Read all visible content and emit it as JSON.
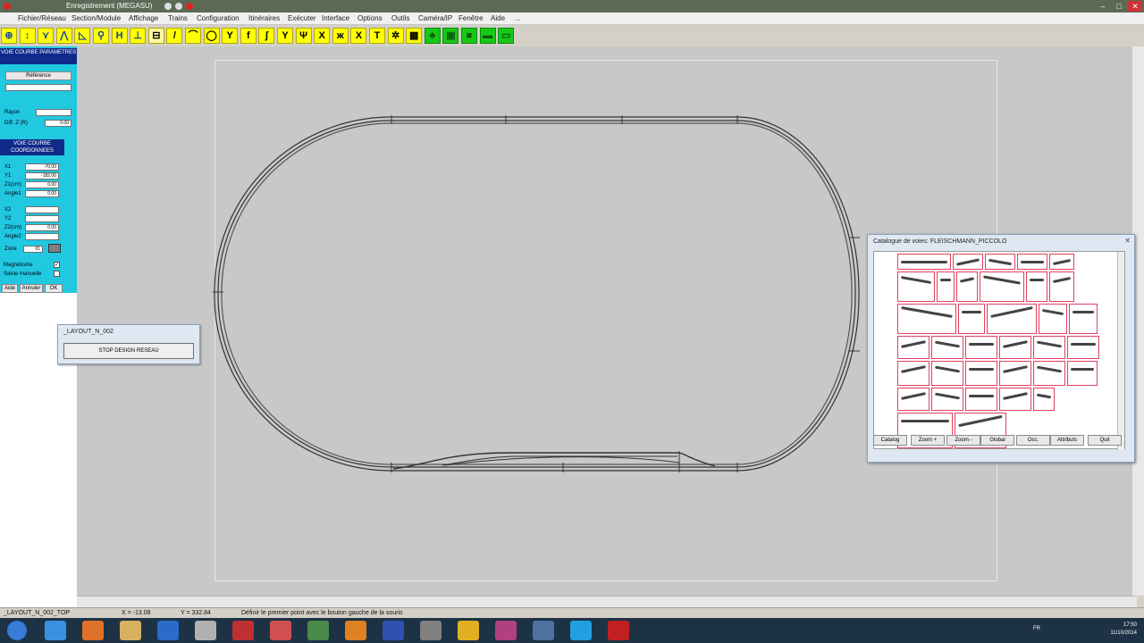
{
  "window": {
    "title": "Enregistrement (MEGASU)",
    "min": "–",
    "max": "□",
    "close": "✕"
  },
  "menu": [
    "Fichier/Réseau",
    "Section/Module",
    "Affichage",
    "Trains",
    "Configuration",
    "Itinéraires",
    "Exécuter",
    "Interface",
    "Options",
    "Outils",
    "Caméra/IP",
    "Fenêtre",
    "Aide",
    "..."
  ],
  "toolbar": {
    "buttons": [
      {
        "name": "globe-icon",
        "glyph": "⊕",
        "style": "blue"
      },
      {
        "name": "straight-track-icon",
        "glyph": "↕",
        "style": "blue"
      },
      {
        "name": "track-tool-icon",
        "glyph": "⋎",
        "style": "blue"
      },
      {
        "name": "double-track-icon",
        "glyph": "⋀",
        "style": "blue"
      },
      {
        "name": "track-end-icon",
        "glyph": "◺",
        "style": "blue"
      },
      {
        "name": "signal-tool-icon",
        "glyph": "⚲",
        "style": "blue"
      },
      {
        "name": "connector-icon",
        "glyph": "H",
        "style": "blue"
      },
      {
        "name": "bridge-icon",
        "glyph": "⊥",
        "style": "blue"
      },
      {
        "name": "track-catalog-icon",
        "glyph": "⊟",
        "style": "sel"
      },
      {
        "name": "line-draw-icon",
        "glyph": "/",
        "style": "y"
      },
      {
        "name": "curve-draw-icon",
        "glyph": "⌒",
        "style": "y"
      },
      {
        "name": "circle-track-icon",
        "glyph": "◯",
        "style": "y"
      },
      {
        "name": "turnout-icon",
        "glyph": "Y",
        "style": "y"
      },
      {
        "name": "turnout-left-icon",
        "glyph": "f",
        "style": "y"
      },
      {
        "name": "turnout-right-icon",
        "glyph": "ʃ",
        "style": "y"
      },
      {
        "name": "wye-icon",
        "glyph": "Y",
        "style": "y"
      },
      {
        "name": "three-way-icon",
        "glyph": "Ψ",
        "style": "y"
      },
      {
        "name": "crossing-icon",
        "glyph": "X",
        "style": "y"
      },
      {
        "name": "double-slip-icon",
        "glyph": "ж",
        "style": "y"
      },
      {
        "name": "diamond-crossing-icon",
        "glyph": "X",
        "style": "y"
      },
      {
        "name": "buffer-icon",
        "glyph": "T",
        "style": "y"
      },
      {
        "name": "turntable-icon",
        "glyph": "✲",
        "style": "y"
      },
      {
        "name": "building-icon",
        "glyph": "▦",
        "style": "y"
      },
      {
        "name": "tree-icon",
        "glyph": "♣",
        "style": "green"
      },
      {
        "name": "scenery-icon",
        "glyph": "▣",
        "style": "green"
      },
      {
        "name": "platform-icon",
        "glyph": "■",
        "style": "green"
      },
      {
        "name": "road-icon",
        "glyph": "▬",
        "style": "green"
      },
      {
        "name": "grass-icon",
        "glyph": "▭",
        "style": "green"
      }
    ]
  },
  "leftpanel": {
    "header1": "VOIE COURBE PARAMETRES",
    "ref_label": "Référence",
    "rayon_label": "Rayon",
    "diffz_label": "Diff. Z (R)",
    "diffz_value": "0.00",
    "header2": "VOIE COURBE COORDONNEES",
    "x1_label": "X1",
    "x1_value": "-70.00",
    "y1_label": "Y1",
    "y1_value": "-182.00",
    "z1_label": "Z1(cm)",
    "z1_value": "0.00",
    "angle1_label": "Angle1",
    "angle1_value": "0.00",
    "x2_label": "X2",
    "y2_label": "Y2",
    "z2_label": "Z2(cm)",
    "z2_value": "0.00",
    "angle2_label": "Angle2",
    "zone_label": "Zone",
    "zone_value": "01",
    "magnetisme_label": "Magnétisme",
    "saisie_label": "Saisie manuelle",
    "btn_aide": "Aide",
    "btn_annuler": "Annuler",
    "btn_ok": "OK"
  },
  "layout_dialog": {
    "title": "_LAYOUT_N_002",
    "button": "STOP DESIGN RESEAU"
  },
  "catalog": {
    "title": "Catalogue de voies: FLEISCHMANN_PICCOLO",
    "close": "✕",
    "buttons": [
      "Catalog",
      "Zoom +",
      "Zoom -",
      "Global",
      "Occ.",
      "Attributs",
      "Quit"
    ]
  },
  "statusbar": {
    "layout": "_LAYOUT_N_002_TOP",
    "x": "X = -13.08",
    "y": "Y = 332.84",
    "message": "Définir le premier point avec le bouton gauche de la souris"
  },
  "taskbar": {
    "icons": [
      "start-icon",
      "ie-icon",
      "firefox-icon",
      "explorer-icon",
      "app-icon",
      "tool-icon",
      "filezilla-icon",
      "app2-icon",
      "photo-icon",
      "vlc-icon",
      "network-icon",
      "app3-icon",
      "chrome-icon",
      "app4-icon",
      "app5-icon",
      "skype-icon",
      "app6-icon"
    ],
    "lang": "FR",
    "time": "17:50",
    "date": "11/10/2014"
  },
  "colors": {
    "panel": "#20c8e0",
    "panelhead": "#102a8a",
    "canvas": "#c8c8c8",
    "tool_yellow": "#ffff00",
    "tool_green": "#18c818",
    "catalog_cell_border": "#e04060"
  }
}
